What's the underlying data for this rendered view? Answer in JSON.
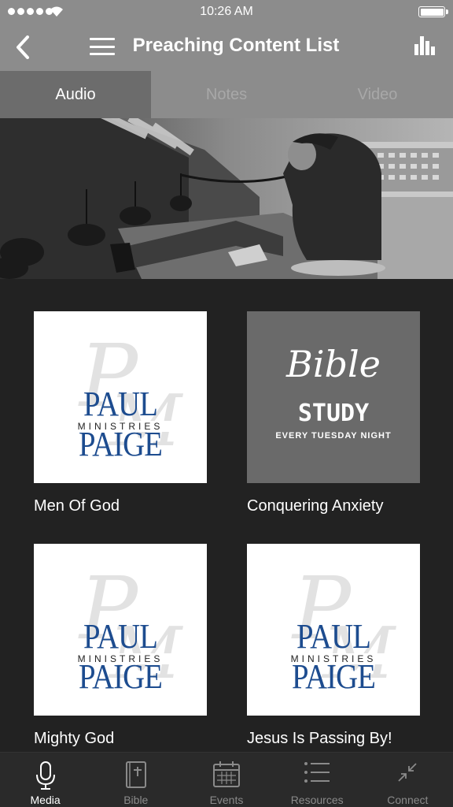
{
  "status_bar": {
    "time": "10:26 AM",
    "icons": [
      "signal-dots-icon",
      "wifi-icon",
      "battery-icon"
    ]
  },
  "nav": {
    "title": "Preaching Content List",
    "icons": [
      "back-chevron-icon",
      "hamburger-menu-icon",
      "bar-chart-icon"
    ]
  },
  "tabs": [
    {
      "label": "Audio",
      "active": true
    },
    {
      "label": "Notes",
      "active": false
    },
    {
      "label": "Video",
      "active": false
    }
  ],
  "items": [
    {
      "title": "Men Of God",
      "thumbnail": {
        "type": "ppm",
        "logo_main": "PAUL PAIGE",
        "logo_sub": "MINISTRIES"
      }
    },
    {
      "title": "Conquering Anxiety",
      "thumbnail": {
        "type": "bible",
        "line1": "Bible",
        "line2": "STUDY",
        "line3": "EVERY TUESDAY NIGHT"
      }
    },
    {
      "title": "Mighty God",
      "thumbnail": {
        "type": "ppm",
        "logo_main": "PAUL PAIGE",
        "logo_sub": "MINISTRIES"
      }
    },
    {
      "title": "Jesus Is Passing By!",
      "thumbnail": {
        "type": "ppm",
        "logo_main": "PAUL PAIGE",
        "logo_sub": "MINISTRIES"
      }
    }
  ],
  "tab_bar": [
    {
      "label": "Media",
      "icon": "microphone-icon",
      "active": true
    },
    {
      "label": "Bible",
      "icon": "bible-book-icon",
      "active": false
    },
    {
      "label": "Events",
      "icon": "calendar-icon",
      "active": false
    },
    {
      "label": "Resources",
      "icon": "list-icon",
      "active": false
    },
    {
      "label": "Connect",
      "icon": "collapse-arrows-icon",
      "active": false
    }
  ],
  "colors": {
    "header_bg": "#8c8c8c",
    "active_tab_bg": "#6c6c6c",
    "content_bg": "#222222",
    "logo_blue": "#1d4c8f"
  }
}
